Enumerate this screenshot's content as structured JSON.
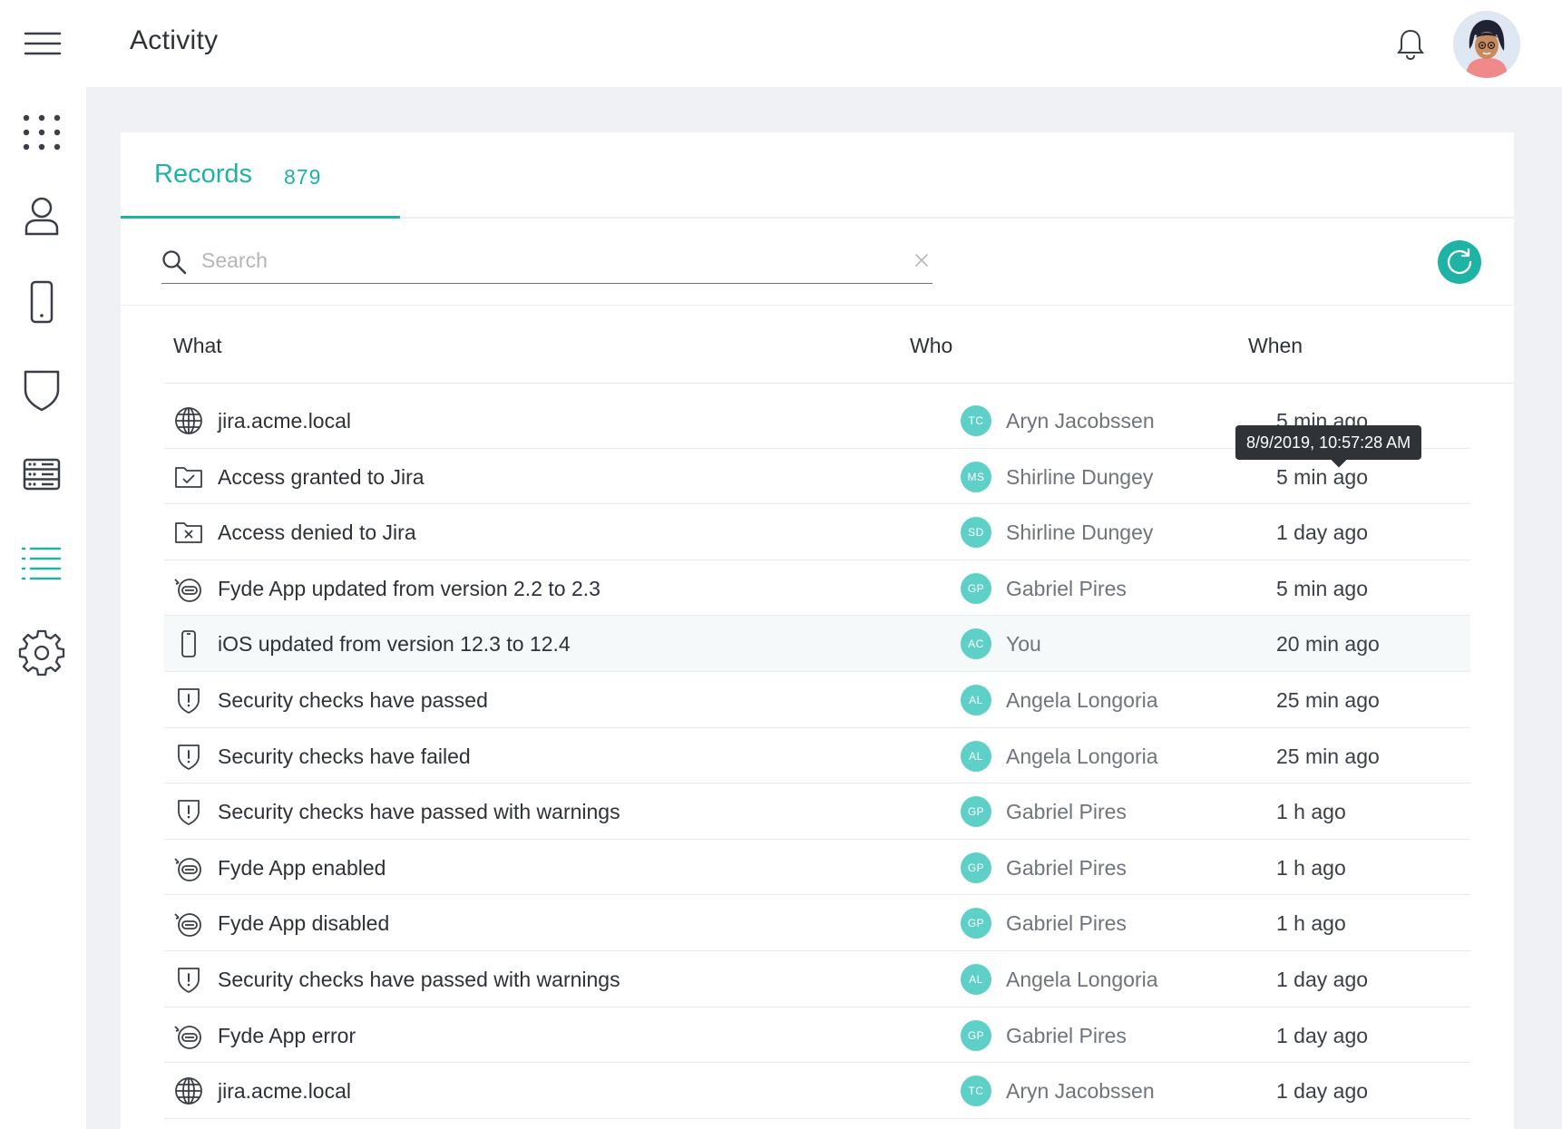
{
  "header": {
    "title": "Activity"
  },
  "sidebar": {
    "items": [
      {
        "name": "apps",
        "icon": "grid-dots-icon",
        "active": false
      },
      {
        "name": "users",
        "icon": "user-icon",
        "active": false
      },
      {
        "name": "devices",
        "icon": "smartphone-icon",
        "active": false
      },
      {
        "name": "security",
        "icon": "shield-icon",
        "active": false
      },
      {
        "name": "resources",
        "icon": "server-icon",
        "active": false
      },
      {
        "name": "activity",
        "icon": "list-icon",
        "active": true
      },
      {
        "name": "settings",
        "icon": "gear-icon",
        "active": false
      }
    ]
  },
  "colors": {
    "accent": "#1fb3a6",
    "badge": "#5ed0c7",
    "tooltip": "#2f3338"
  },
  "tabs": [
    {
      "label": "Records",
      "count": "879"
    }
  ],
  "search": {
    "placeholder": "Search",
    "value": ""
  },
  "table": {
    "headers": {
      "what": "What",
      "who": "Who",
      "when": "When"
    },
    "rows": [
      {
        "icon": "globe-icon",
        "what": "jira.acme.local",
        "initials": "TC",
        "who": "Aryn Jacobssen",
        "when": "5 min ago"
      },
      {
        "icon": "folder-check-icon",
        "what": "Access granted to Jira",
        "initials": "MS",
        "who": "Shirline Dungey",
        "when": "5 min ago"
      },
      {
        "icon": "folder-x-icon",
        "what": "Access denied to Jira",
        "initials": "SD",
        "who": "Shirline Dungey",
        "when": "1 day ago"
      },
      {
        "icon": "fyde-app-icon",
        "what": "Fyde App updated from version 2.2 to 2.3",
        "initials": "GP",
        "who": "Gabriel Pires",
        "when": "5 min ago"
      },
      {
        "icon": "smartphone-icon",
        "what": "iOS updated from version 12.3 to 12.4",
        "initials": "AC",
        "who": "You",
        "when": "20 min ago"
      },
      {
        "icon": "shield-alert-icon",
        "what": "Security checks have passed",
        "initials": "AL",
        "who": "Angela Longoria",
        "when": "25 min ago"
      },
      {
        "icon": "shield-alert-icon",
        "what": "Security checks have failed",
        "initials": "AL",
        "who": "Angela Longoria",
        "when": "25 min ago"
      },
      {
        "icon": "shield-alert-icon",
        "what": "Security checks have passed with warnings",
        "initials": "GP",
        "who": "Gabriel Pires",
        "when": "1 h ago"
      },
      {
        "icon": "fyde-app-icon",
        "what": "Fyde App enabled",
        "initials": "GP",
        "who": "Gabriel Pires",
        "when": "1 h ago"
      },
      {
        "icon": "fyde-app-icon",
        "what": "Fyde App disabled",
        "initials": "GP",
        "who": "Gabriel Pires",
        "when": "1 h ago"
      },
      {
        "icon": "shield-alert-icon",
        "what": "Security checks have passed with warnings",
        "initials": "AL",
        "who": "Angela Longoria",
        "when": "1 day ago"
      },
      {
        "icon": "fyde-app-icon",
        "what": "Fyde App error",
        "initials": "GP",
        "who": "Gabriel Pires",
        "when": "1 day ago"
      },
      {
        "icon": "globe-icon",
        "what": "jira.acme.local",
        "initials": "TC",
        "who": "Aryn Jacobssen",
        "when": "1 day ago"
      }
    ]
  },
  "tooltip": {
    "text": "8/9/2019, 10:57:28 AM"
  }
}
